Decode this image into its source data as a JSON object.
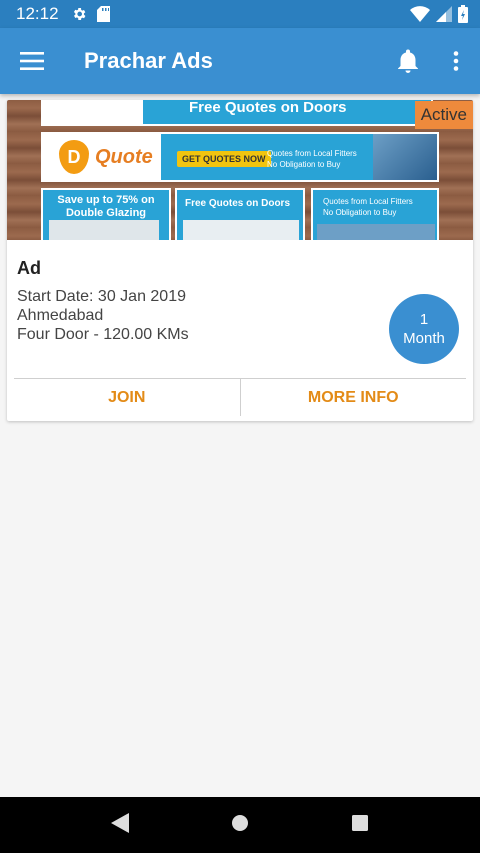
{
  "status_bar": {
    "time": "12:12"
  },
  "app_bar": {
    "title": "Prachar Ads"
  },
  "card": {
    "badge": "Active",
    "banner": {
      "ad1": "Free Quotes on Doors",
      "ad2_logo": "Quote",
      "ad2_cta": "GET QUOTES NOW",
      "ad2_bullets": [
        "Quotes from Local Fitters",
        "No Obligation to Buy"
      ],
      "ad3": "Save up to 75% on Double Glazing",
      "ad4": "Free Quotes on Doors",
      "ad5_bullets": [
        "Quotes from Local Fitters",
        "No Obligation to Buy"
      ]
    },
    "title": "Ad",
    "start_date": "Start Date: 30 Jan 2019",
    "city": "Ahmedabad",
    "vehicle": "Four Door - 120.00 KMs",
    "duration": {
      "number": "1",
      "unit": "Month"
    },
    "join_label": "JOIN",
    "more_info_label": "MORE INFO"
  },
  "colors": {
    "primary": "#3a8fd1",
    "status": "#2b7fbf",
    "accent": "#e38b17",
    "badge": "#ee8a3c"
  },
  "icons": {
    "menu": "hamburger-icon",
    "bell": "bell-icon",
    "more": "more-vert-icon",
    "back": "back-icon",
    "home": "home-icon",
    "recents": "recents-icon"
  }
}
